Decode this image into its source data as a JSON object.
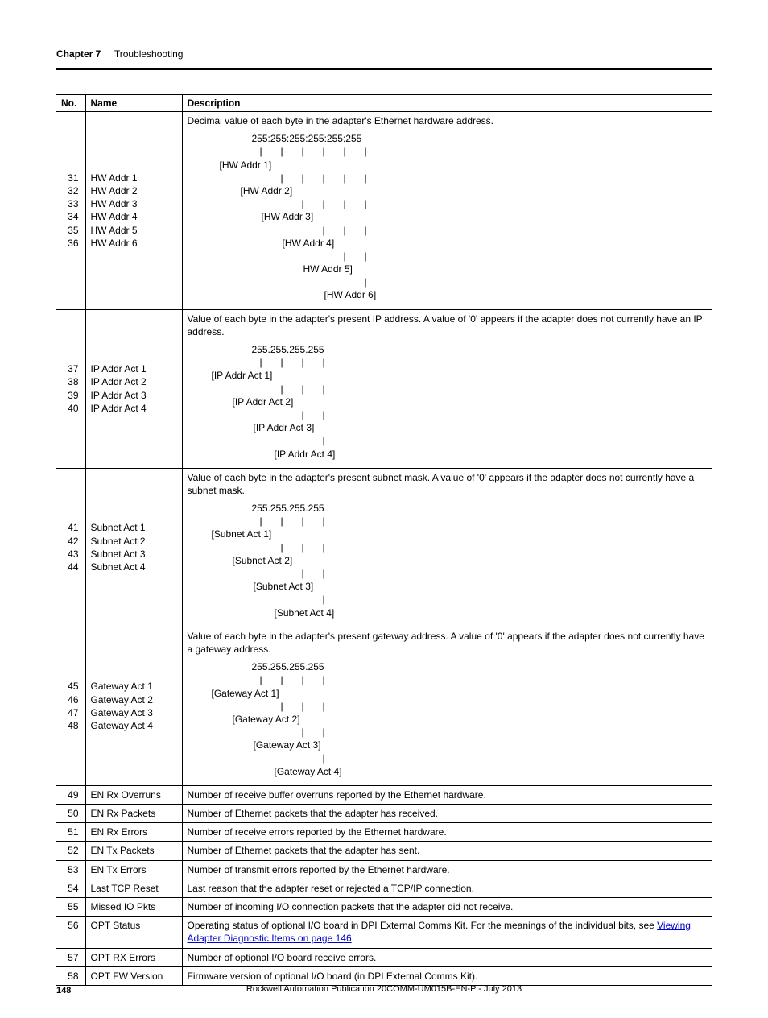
{
  "header": {
    "chapter_label": "Chapter 7",
    "chapter_title": "Troubleshooting"
  },
  "table": {
    "headers": {
      "no": "No.",
      "name": "Name",
      "desc": "Description"
    },
    "rows": [
      {
        "no": "31\n32\n33\n34\n35\n36",
        "name": "HW Addr 1\nHW Addr 2\nHW Addr 3\nHW Addr 4\nHW Addr 5\nHW Addr 6",
        "desc_intro": "Decimal value of each byte in the adapter's Ethernet hardware address.",
        "diagram_header": "255:255:255:255:255:255",
        "diagram_labels": [
          "[HW Addr 1]",
          "[HW Addr 2]",
          "[HW Addr 3]",
          "[HW Addr 4]",
          "HW Addr 5]",
          "[HW Addr 6]"
        ]
      },
      {
        "no": "37\n38\n39\n40",
        "name": "IP Addr Act 1\nIP Addr Act 2\nIP Addr Act 3\nIP Addr Act 4",
        "desc_intro": "Value of each byte in the adapter's present IP address. A value of '0' appears if the adapter does not currently have an IP address.",
        "diagram_header": "255.255.255.255",
        "diagram_labels": [
          "[IP Addr Act 1]",
          "[IP Addr Act 2]",
          "[IP Addr Act 3]",
          "[IP Addr Act 4]"
        ]
      },
      {
        "no": "41\n42\n43\n44",
        "name": "Subnet Act 1\nSubnet Act 2\nSubnet Act 3\nSubnet Act 4",
        "desc_intro": "Value of each byte in the adapter's present subnet mask. A value of '0' appears if the adapter does not currently have a subnet mask.",
        "diagram_header": "255.255.255.255",
        "diagram_labels": [
          "[Subnet Act 1]",
          "[Subnet Act 2]",
          "[Subnet Act 3]",
          "[Subnet Act 4]"
        ]
      },
      {
        "no": "45\n46\n47\n48",
        "name": "Gateway Act 1\nGateway Act 2\nGateway Act 3\nGateway Act 4",
        "desc_intro": "Value of each byte in the adapter's present gateway address. A value of '0' appears if the adapter does not currently have a gateway address.",
        "diagram_header": "255.255.255.255",
        "diagram_labels": [
          "[Gateway Act 1]",
          "[Gateway Act 2]",
          "[Gateway Act 3]",
          "[Gateway Act 4]"
        ]
      },
      {
        "no": "49",
        "name": "EN Rx Overruns",
        "desc_plain": "Number of receive buffer overruns reported by the Ethernet hardware."
      },
      {
        "no": "50",
        "name": "EN Rx Packets",
        "desc_plain": "Number of Ethernet packets that the adapter has received."
      },
      {
        "no": "51",
        "name": "EN Rx Errors",
        "desc_plain": "Number of receive errors reported by the Ethernet hardware."
      },
      {
        "no": "52",
        "name": "EN Tx Packets",
        "desc_plain": "Number of Ethernet packets that the adapter has sent."
      },
      {
        "no": "53",
        "name": "EN Tx Errors",
        "desc_plain": "Number of transmit errors reported by the Ethernet hardware."
      },
      {
        "no": "54",
        "name": "Last TCP Reset",
        "desc_plain": "Last reason that the adapter reset or rejected a TCP/IP connection."
      },
      {
        "no": "55",
        "name": "Missed IO Pkts",
        "desc_plain": "Number of incoming I/O connection packets that the adapter did not receive."
      },
      {
        "no": "56",
        "name": "OPT Status",
        "desc_pre_link": "Operating status of optional I/O board in DPI External Comms Kit. For the meanings of the individual bits, see ",
        "link_text": "Viewing Adapter Diagnostic Items on page 146",
        "desc_post_link": "."
      },
      {
        "no": "57",
        "name": "OPT RX Errors",
        "desc_plain": "Number of optional I/O board receive errors."
      },
      {
        "no": "58",
        "name": "OPT FW Version",
        "desc_plain": "Firmware version of optional I/O board (in DPI External Comms Kit)."
      }
    ]
  },
  "footer": {
    "page_number": "148",
    "publication": "Rockwell Automation Publication 20COMM-UM015B-EN-P - July 2013"
  }
}
